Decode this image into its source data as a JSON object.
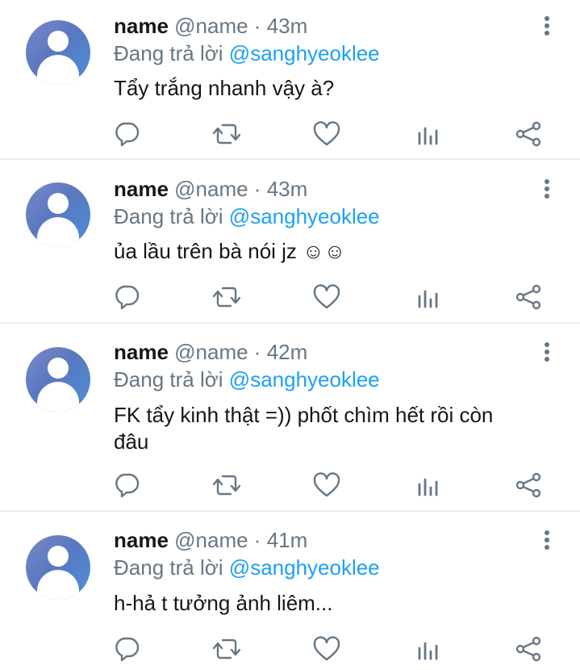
{
  "tweets": [
    {
      "name": "name",
      "handle_time": "@name · 43m",
      "reply_prefix": "Đang trả lời",
      "reply_handle": "@sanghyeoklee",
      "text": "Tẩy trắng nhanh vậy à?"
    },
    {
      "name": "name",
      "handle_time": "@name · 43m",
      "reply_prefix": "Đang trả lời",
      "reply_handle": "@sanghyeoklee",
      "text": "ủa lầu trên bà nói jz ☺☺"
    },
    {
      "name": "name",
      "handle_time": "@name · 42m",
      "reply_prefix": "Đang trả lời",
      "reply_handle": "@sanghyeoklee",
      "text": "FK tẩy kinh thật =)) phốt chìm hết rồi còn đâu"
    },
    {
      "name": "name",
      "handle_time": "@name · 41m",
      "reply_prefix": "Đang trả lời",
      "reply_handle": "@sanghyeoklee",
      "text": "h-hả t tưởng ảnh liêm..."
    }
  ],
  "icons": {
    "more": "more-vertical-icon",
    "reply": "reply-icon",
    "retweet": "retweet-icon",
    "like": "heart-icon",
    "analytics": "analytics-icon",
    "share": "share-icon"
  },
  "colors": {
    "link": "#1da1f2",
    "secondary": "#657786",
    "primary_text": "#14171a",
    "divider": "#e6ecf0"
  }
}
